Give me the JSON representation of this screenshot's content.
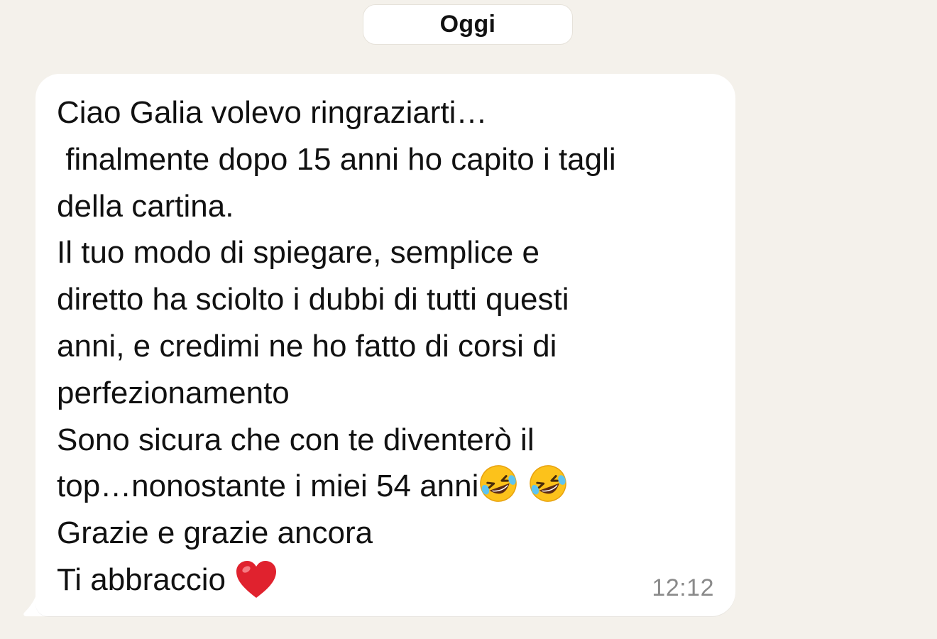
{
  "date_separator": "Oggi",
  "message": {
    "lines": [
      "Ciao Galia volevo ringraziarti…",
      " finalmente dopo 15 anni ho capito i tagli",
      "della cartina.",
      "Il tuo modo di spiegare, semplice e",
      "diretto ha sciolto i dubbi di tutti questi",
      "anni, e credimi ne ho fatto di corsi di",
      "perfezionamento",
      "Sono sicura che con te diventerò il",
      "top…nonostante i miei 54 anni",
      "Grazie e grazie ancora",
      "Ti abbraccio "
    ],
    "emojis": [
      "rolling-on-floor-laughing",
      "rolling-on-floor-laughing",
      "red-heart"
    ],
    "time": "12:12"
  },
  "colors": {
    "background": "#f4f1eb",
    "bubble": "#ffffff",
    "text": "#111111",
    "timestamp": "#8a8a8a",
    "heart": "#e0222e"
  }
}
